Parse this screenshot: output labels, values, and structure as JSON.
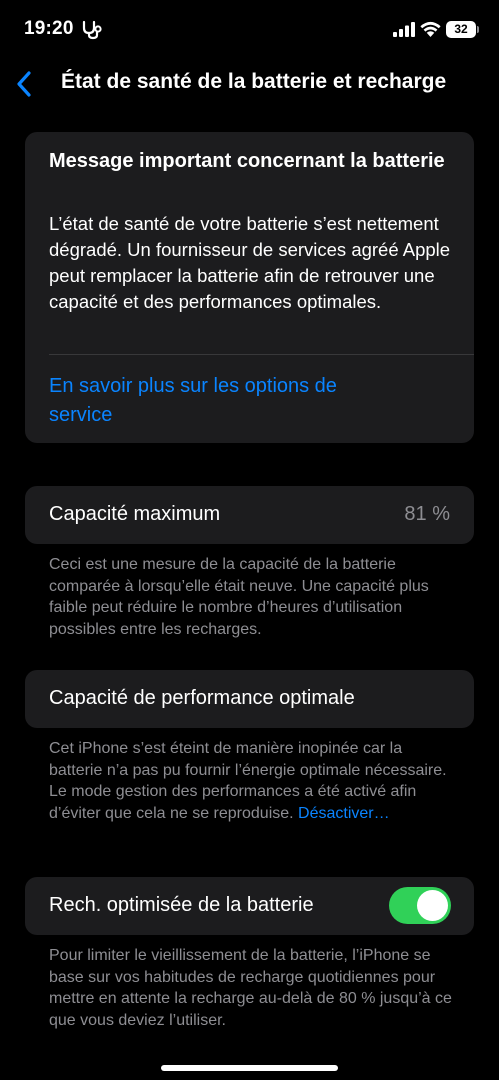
{
  "status_bar": {
    "time": "19:20",
    "battery_level": "32",
    "icons": [
      "stethoscope-icon",
      "cellular-signal-icon",
      "wifi-icon",
      "battery-icon"
    ]
  },
  "nav": {
    "back_icon": "chevron-left-icon",
    "title": "État de santé de la batterie et recharge"
  },
  "message_card": {
    "title": "Message important concernant la batterie",
    "body": "L’état de santé de votre batterie s’est nettement dégradé. Un fournisseur de services agréé Apple peut remplacer la batterie afin de retrouver une capacité et des performances optimales.",
    "link": "En savoir plus sur les options de service"
  },
  "max_capacity": {
    "label": "Capacité maximum",
    "value": "81 %",
    "footnote": "Ceci est une mesure de la capacité de la batterie comparée à lorsqu’elle était neuve. Une capacité plus faible peut réduire le nombre d’heures d’utilisation possibles entre les recharges."
  },
  "peak_performance": {
    "label": "Capacité de performance optimale",
    "footnote": "Cet iPhone s’est éteint de manière inopinée car la batterie n’a pas pu fournir l’énergie optimale nécessaire. Le mode gestion des performances a été activé afin d’éviter que cela ne se reproduise.",
    "footnote_link": "Désactiver…"
  },
  "optimized_charging": {
    "label": "Rech. optimisée de la batterie",
    "toggle_on": true,
    "footnote": "Pour limiter le vieillissement de la batterie, l’iPhone se base sur vos habitudes de recharge quotidiennes pour mettre en attente la recharge au-delà de 80 % jusqu’à ce que vous deviez l’utiliser."
  },
  "colors": {
    "background": "#000000",
    "card": "#1c1c1e",
    "accent_blue": "#0a84ff",
    "toggle_green": "#30d158",
    "secondary_text": "#8e8e93"
  }
}
